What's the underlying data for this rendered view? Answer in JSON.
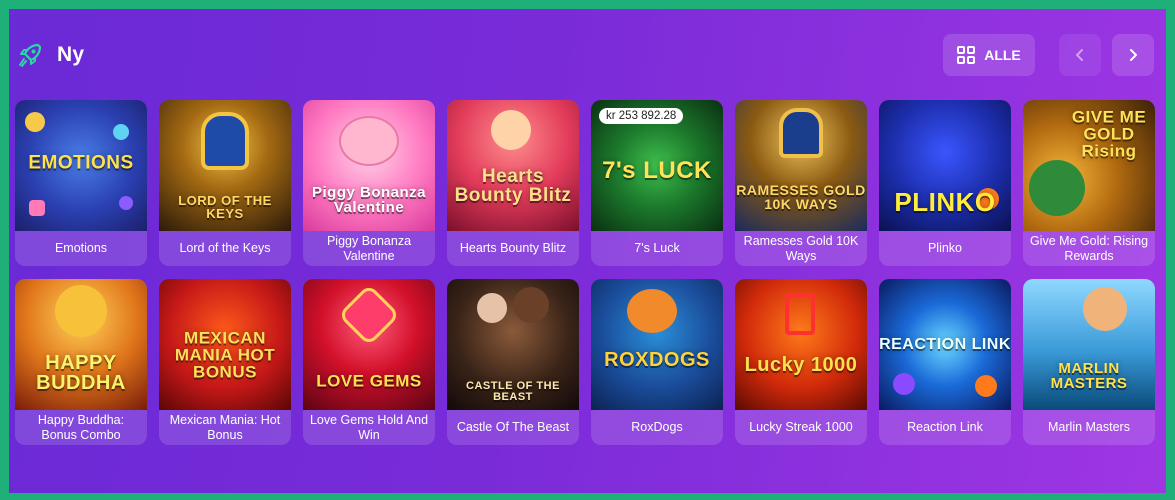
{
  "section": {
    "title": "Ny",
    "icon": "rocket-icon",
    "all_button_label": "ALLE",
    "accent": "#2fd4a6"
  },
  "row1": [
    {
      "label": "Emotions",
      "logo": "EMOTIONS"
    },
    {
      "label": "Lord of the Keys",
      "logo": "LORD OF THE KEYS"
    },
    {
      "label": "Piggy Bonanza Valentine",
      "logo": "Piggy Bonanza Valentine"
    },
    {
      "label": "Hearts Bounty Blitz",
      "logo": "Hearts Bounty Blitz"
    },
    {
      "label": "7's Luck",
      "logo": "7's LUCK",
      "jackpot": "kr 253 892.28"
    },
    {
      "label": "Ramesses Gold 10K Ways",
      "logo": "RAMESSES GOLD 10K WAYS"
    },
    {
      "label": "Plinko",
      "logo": "PLINKO"
    },
    {
      "label": "Give Me Gold: Rising Rewards",
      "logo": "GIVE ME GOLD Rising"
    }
  ],
  "row2": [
    {
      "label": "Happy Buddha: Bonus Combo",
      "logo": "HAPPY BUDDHA"
    },
    {
      "label": "Mexican Mania: Hot Bonus",
      "logo": "MEXICAN MANIA HOT BONUS"
    },
    {
      "label": "Love Gems Hold And Win",
      "logo": "LOVE GEMS"
    },
    {
      "label": "Castle Of The Beast",
      "logo": "CASTLE OF THE BEAST"
    },
    {
      "label": "RoxDogs",
      "logo": "ROXDOGS"
    },
    {
      "label": "Lucky Streak 1000",
      "logo": "Lucky 1000"
    },
    {
      "label": "Reaction Link",
      "logo": "REACTION LINK"
    },
    {
      "label": "Marlin Masters",
      "logo": "MARLIN MASTERS"
    }
  ]
}
